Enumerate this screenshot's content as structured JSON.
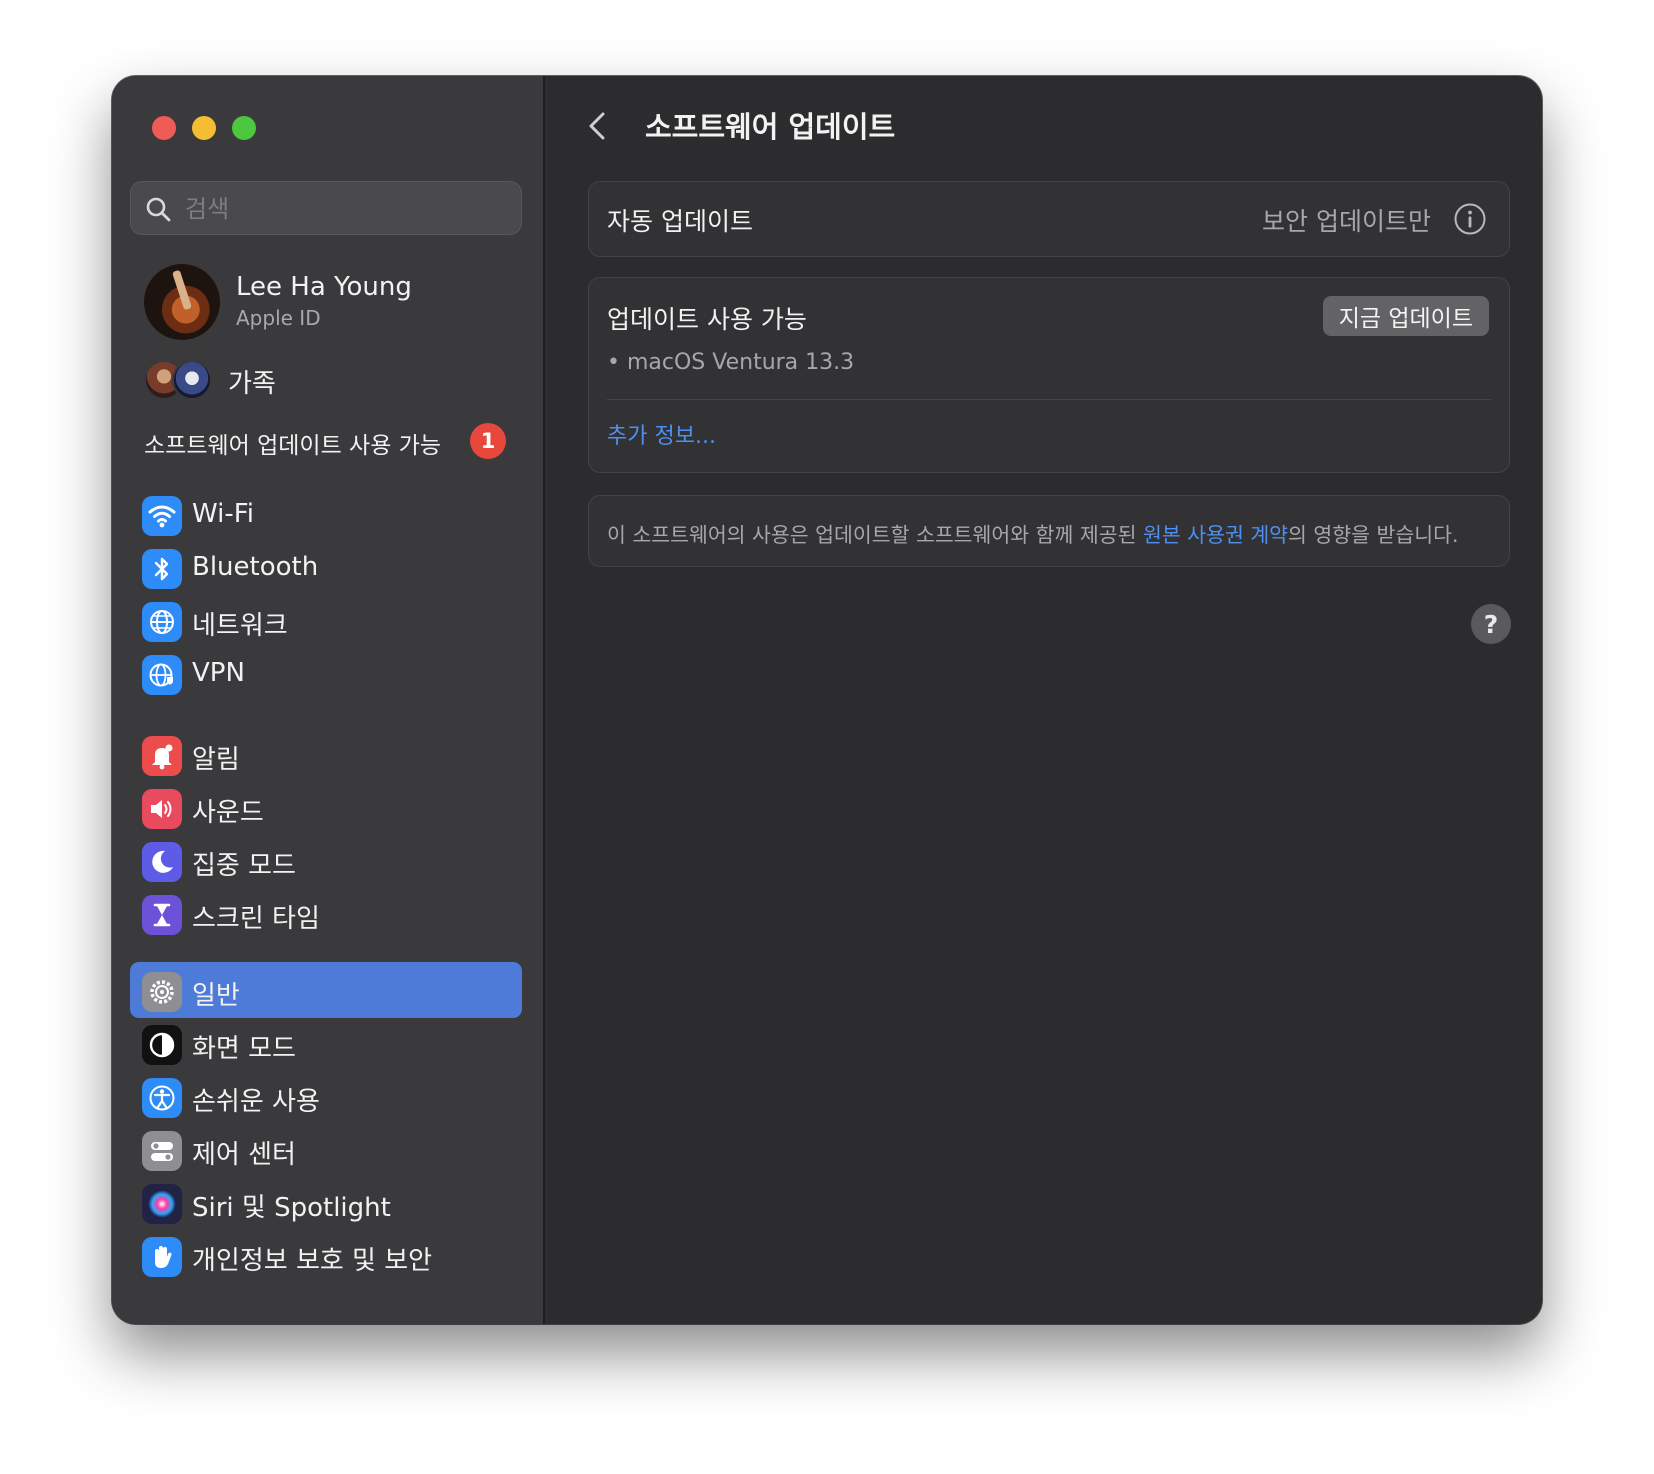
{
  "search": {
    "placeholder": "검색"
  },
  "profile": {
    "name": "Lee Ha Young",
    "subtitle": "Apple ID"
  },
  "family": {
    "label": "가족"
  },
  "sidebar_notice": {
    "label": "소프트웨어 업데이트 사용 가능",
    "badge": "1"
  },
  "nav": [
    {
      "label": "Wi-Fi",
      "icon": "wifi-icon",
      "color": "#2d8cf7"
    },
    {
      "label": "Bluetooth",
      "icon": "bluetooth-icon",
      "color": "#2d8cf7"
    },
    {
      "label": "네트워크",
      "icon": "globe-icon",
      "color": "#2d8cf7"
    },
    {
      "label": "VPN",
      "icon": "vpn-globe-icon",
      "color": "#2d8cf7"
    },
    {
      "label": "알림",
      "icon": "bell-icon",
      "color": "#ed4c4c"
    },
    {
      "label": "사운드",
      "icon": "speaker-icon",
      "color": "#ea4a5e"
    },
    {
      "label": "집중 모드",
      "icon": "moon-icon",
      "color": "#5e5ce6"
    },
    {
      "label": "스크린 타임",
      "icon": "hourglass-icon",
      "color": "#6b52d9"
    },
    {
      "label": "일반",
      "icon": "gear-icon",
      "color": "#8e8e93",
      "selected": true
    },
    {
      "label": "화면 모드",
      "icon": "appearance-icon",
      "color": "#111111"
    },
    {
      "label": "손쉬운 사용",
      "icon": "accessibility-icon",
      "color": "#2d8cf7"
    },
    {
      "label": "제어 센터",
      "icon": "toggles-icon",
      "color": "#8e8e93"
    },
    {
      "label": "Siri 및 Spotlight",
      "icon": "siri-icon",
      "color": "#222244"
    },
    {
      "label": "개인정보 보호 및 보안",
      "icon": "hand-icon",
      "color": "#2d8cf7"
    }
  ],
  "main": {
    "title": "소프트웨어 업데이트",
    "auto_update": {
      "label": "자동 업데이트",
      "value": "보안 업데이트만"
    },
    "available": {
      "heading": "업데이트 사용 가능",
      "button": "지금 업데이트",
      "item": "• macOS Ventura 13.3",
      "more_link": "추가 정보..."
    },
    "license": {
      "before": "이 소프트웨어의 사용은 업데이트할 소프트웨어와 함께 제공된 ",
      "link": "원본 사용권 계약",
      "after": "의 영향을 받습니다."
    },
    "help": "?"
  },
  "colors": {
    "accent": "#4e7bd8",
    "link": "#4f8ff0",
    "badge": "#e8473c"
  }
}
